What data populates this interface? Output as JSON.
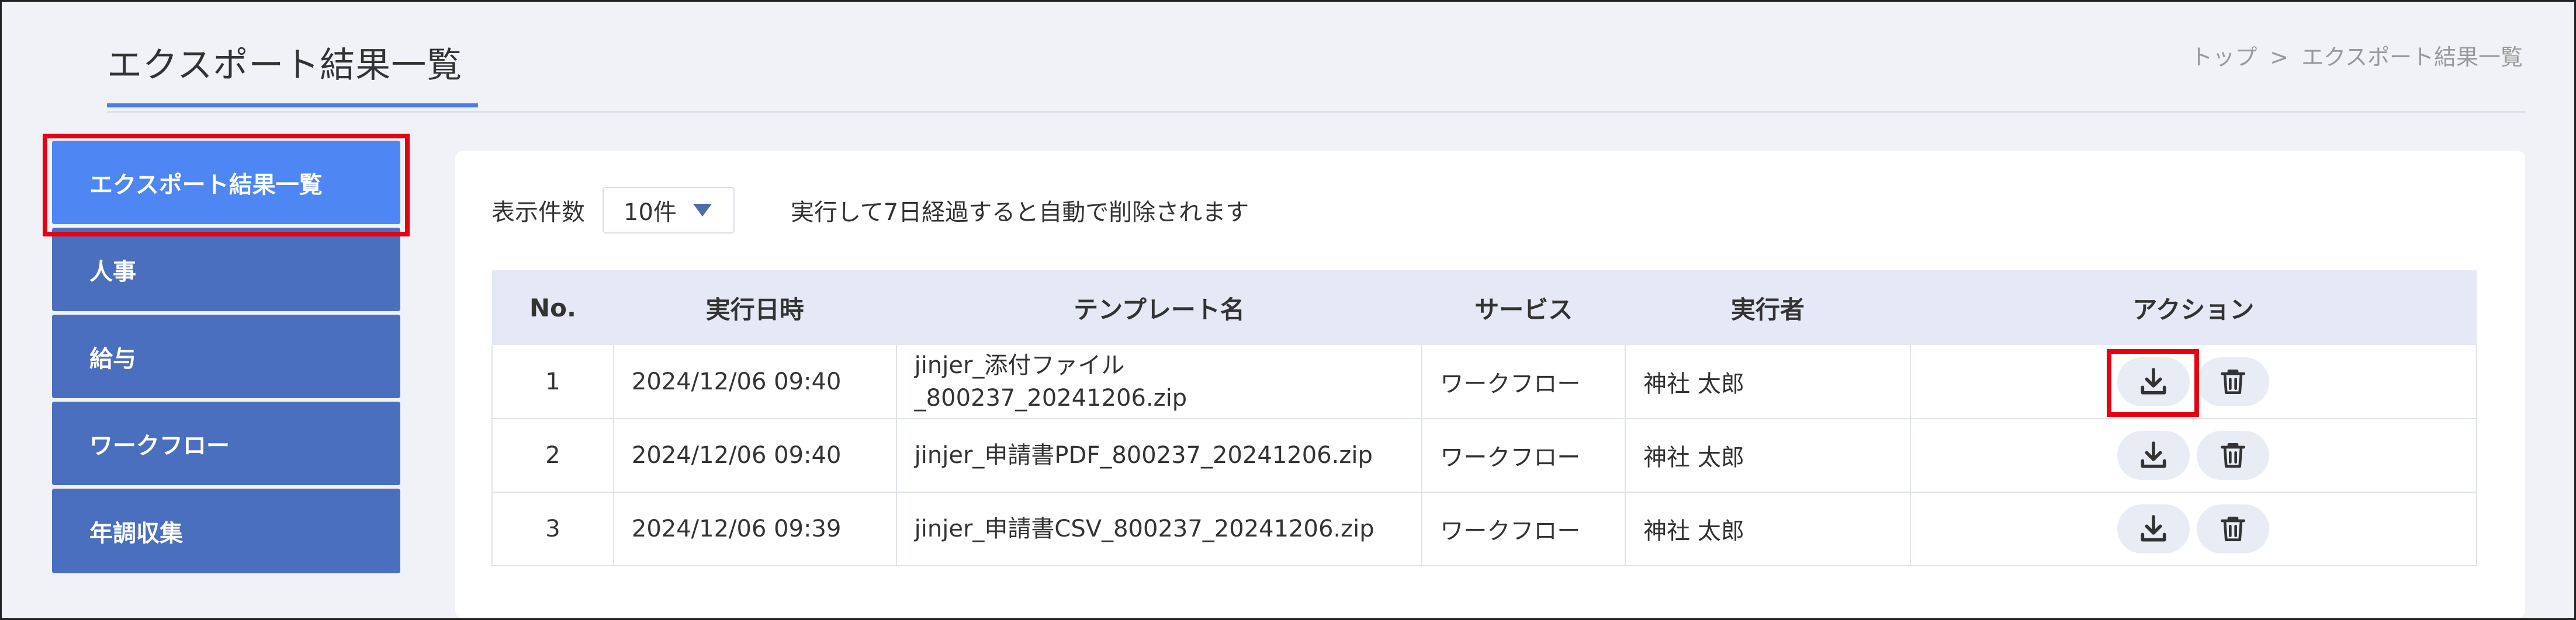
{
  "header": {
    "title": "エクスポート結果一覧",
    "breadcrumb": [
      "トップ",
      ">",
      "エクスポート結果一覧"
    ]
  },
  "sidebar": {
    "items": [
      {
        "label": "エクスポート結果一覧",
        "active": true
      },
      {
        "label": "人事",
        "active": false
      },
      {
        "label": "給与",
        "active": false
      },
      {
        "label": "ワークフロー",
        "active": false
      },
      {
        "label": "年調収集",
        "active": false
      }
    ]
  },
  "toolbar": {
    "count_label": "表示件数",
    "count_value": "10件",
    "notice": "実行して7日経過すると自動で削除されます"
  },
  "table": {
    "headers": [
      "No.",
      "実行日時",
      "テンプレート名",
      "サービス",
      "実行者",
      "アクション"
    ],
    "rows": [
      {
        "no": "1",
        "datetime": "2024/12/06 09:40",
        "template_line1": "jinjer_添付ファイル",
        "template_line2": "_800237_20241206.zip",
        "service": "ワークフロー",
        "user": "神社 太郎"
      },
      {
        "no": "2",
        "datetime": "2024/12/06 09:40",
        "template_line1": "jinjer_申請書PDF_800237_20241206.zip",
        "template_line2": "",
        "service": "ワークフロー",
        "user": "神社 太郎"
      },
      {
        "no": "3",
        "datetime": "2024/12/06 09:39",
        "template_line1": "jinjer_申請書CSV_800237_20241206.zip",
        "template_line2": "",
        "service": "ワークフロー",
        "user": "神社 太郎"
      }
    ]
  },
  "icons": {
    "download": "download-icon",
    "delete": "trash-icon",
    "dropdown": "caret-down-icon"
  },
  "colors": {
    "sidebar": "#4b6fbf",
    "sidebar_active": "#4e87f3",
    "highlight": "#e60012",
    "accent": "#4f7cec"
  }
}
